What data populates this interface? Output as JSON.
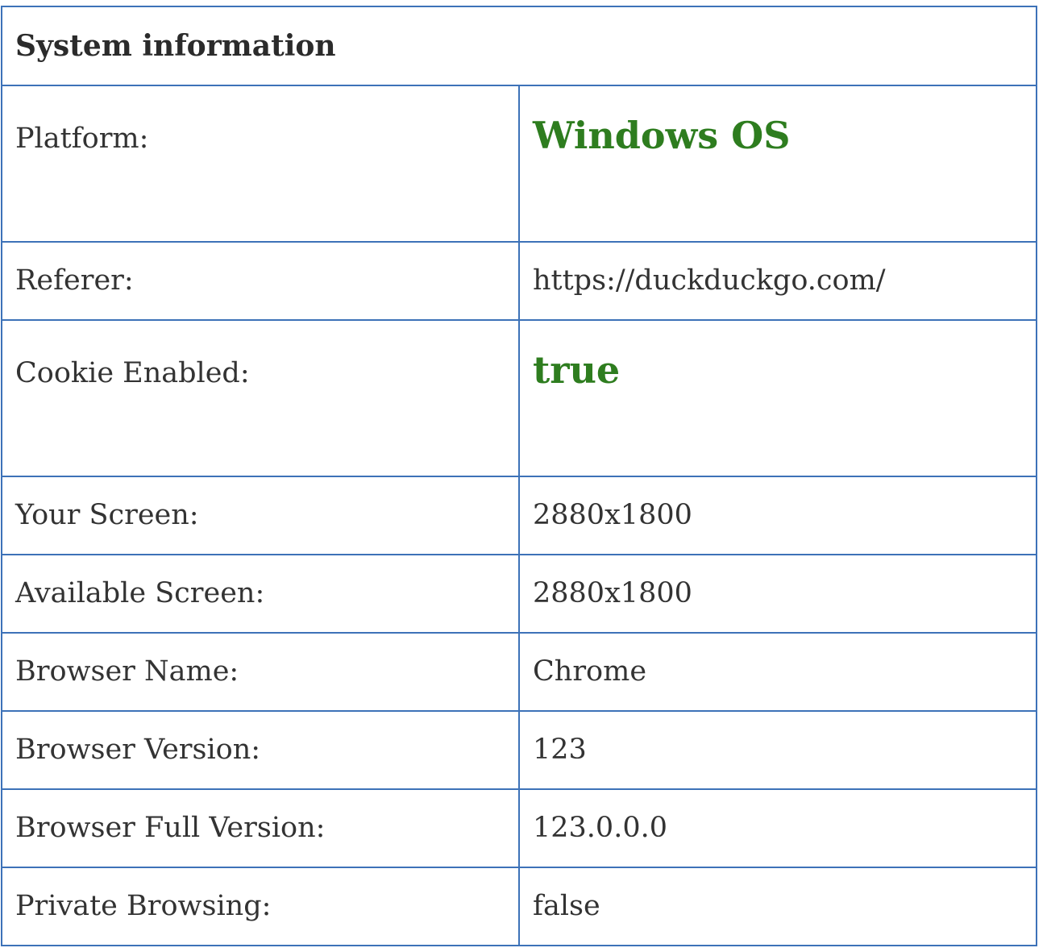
{
  "title": "System information",
  "rows": [
    {
      "label": "Platform:",
      "value": "Windows OS"
    },
    {
      "label": "Referer:",
      "value": "https://duckduckgo.com/"
    },
    {
      "label": "Cookie Enabled:",
      "value": "true"
    },
    {
      "label": "Your Screen:",
      "value": "2880x1800"
    },
    {
      "label": "Available Screen:",
      "value": "2880x1800"
    },
    {
      "label": "Browser Name:",
      "value": "Chrome"
    },
    {
      "label": "Browser Version:",
      "value": "123"
    },
    {
      "label": "Browser Full Version:",
      "value": "123.0.0.0"
    },
    {
      "label": "Private Browsing:",
      "value": "false"
    }
  ],
  "colors": {
    "border": "#3d72b8",
    "highlight": "#2e7d1f",
    "text": "#333333"
  }
}
